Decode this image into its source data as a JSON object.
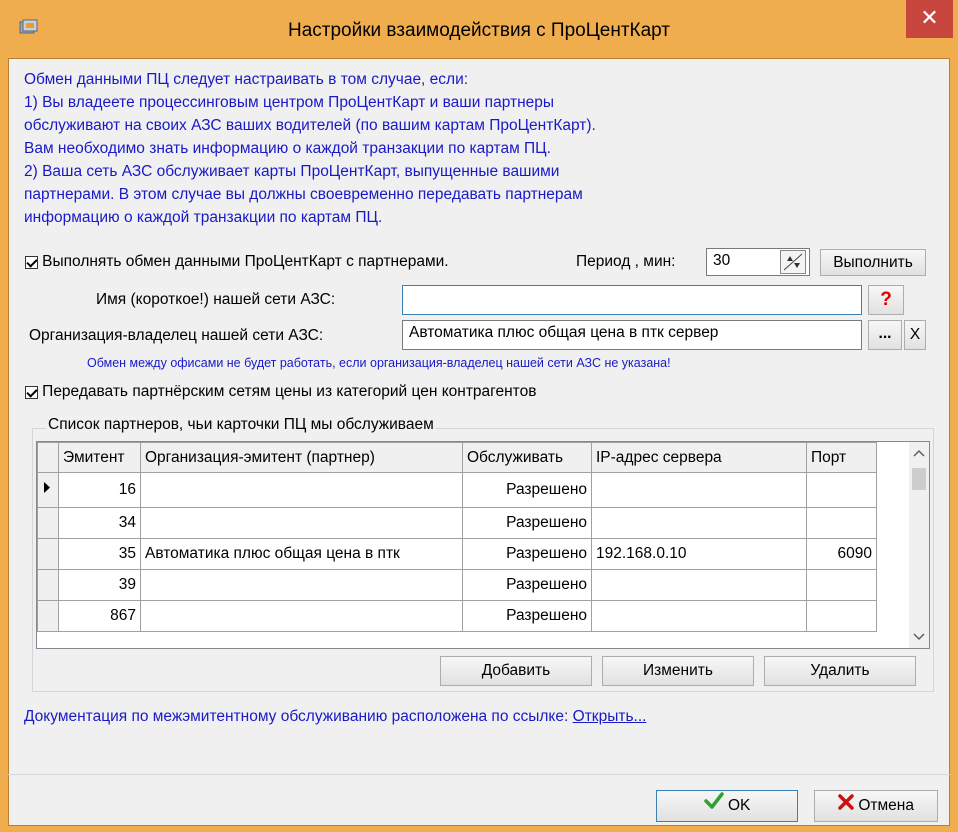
{
  "window": {
    "title": "Настройки взаимодействия с ПроЦентКарт",
    "close_label": "✕"
  },
  "info_lines": [
    "Обмен данными ПЦ следует настраивать в том случае, если:",
    "1) Вы владеете процессинговым центром ПроЦентКарт и ваши партнеры",
    "обслуживают на своих АЗС ваших водителей (по вашим картам ПроЦентКарт).",
    "Вам необходимо знать информацию о каждой транзакции по картам ПЦ.",
    "2) Ваша сеть АЗС обслуживает карты ПроЦентКарт, выпущенные вашими",
    "партнерами. В этом случае вы должны своевременно передавать партнерам",
    "информацию о каждой транзакции по картам ПЦ."
  ],
  "exchange": {
    "checkbox_label": "Выполнять обмен данными ПроЦентКарт с партнерами.",
    "checked": true,
    "period_label": "Период , мин:",
    "period_value": "30",
    "run_label": "Выполнить"
  },
  "network_name": {
    "label": "Имя (короткое!) нашей сети АЗС:",
    "value": "",
    "help_label": "?"
  },
  "owner_org": {
    "label": "Организация-владелец нашей сети АЗС:",
    "value": "Автоматика плюс общая цена в птк сервер",
    "browse_label": "...",
    "clear_label": "X",
    "warning": "Обмен между офисами не будет работать, если организация-владелец нашей сети АЗС не указана!"
  },
  "prices": {
    "checkbox_label": "Передавать партнёрским сетям цены из категорий цен контрагентов",
    "checked": true
  },
  "partners": {
    "group_title": "Список партнеров, чьи карточки ПЦ мы обслуживаем",
    "columns": [
      "Эмитент",
      "Организация-эмитент (партнер)",
      "Обслуживать",
      "IP-адрес сервера",
      "Порт"
    ],
    "rows": [
      {
        "emitent": "16",
        "org": "",
        "serve": "Разрешено",
        "ip": "",
        "port": ""
      },
      {
        "emitent": "34",
        "org": "",
        "serve": "Разрешено",
        "ip": "",
        "port": ""
      },
      {
        "emitent": "35",
        "org": "Автоматика плюс общая цена в птк",
        "serve": "Разрешено",
        "ip": "192.168.0.10",
        "port": "6090"
      },
      {
        "emitent": "39",
        "org": "",
        "serve": "Разрешено",
        "ip": "",
        "port": ""
      },
      {
        "emitent": "867",
        "org": "",
        "serve": "Разрешено",
        "ip": "",
        "port": ""
      }
    ],
    "add_label": "Добавить",
    "edit_label": "Изменить",
    "delete_label": "Удалить"
  },
  "docs": {
    "text": "Документация по межэмитентному обслуживанию расположена по ссылке:",
    "link": "Открыть..."
  },
  "footer": {
    "ok_label": "OK",
    "cancel_label": "Отмена"
  },
  "colors": {
    "title_bar": "#f0ad4e",
    "close": "#c7463d",
    "info_text": "#1919c8",
    "help": "#e00000"
  }
}
